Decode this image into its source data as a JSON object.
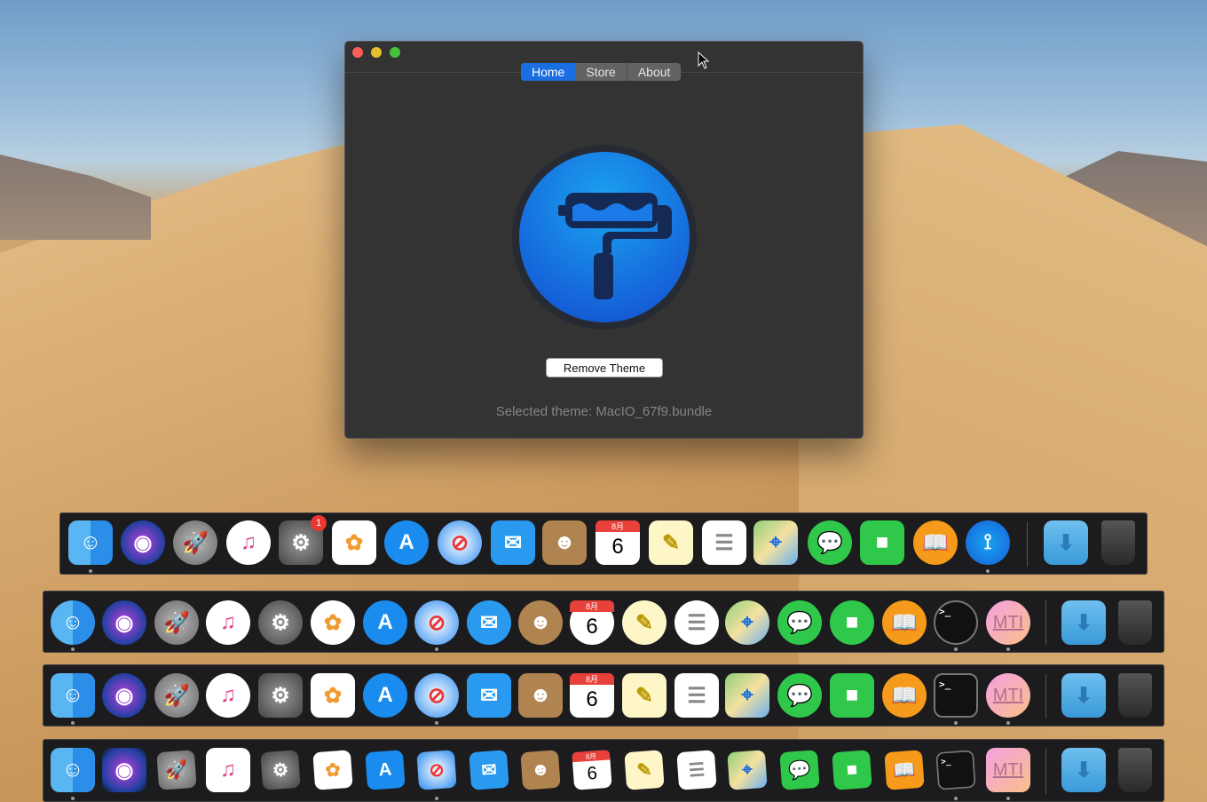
{
  "window": {
    "tabs": [
      {
        "label": "Home",
        "active": true
      },
      {
        "label": "Store",
        "active": false
      },
      {
        "label": "About",
        "active": false
      }
    ],
    "remove_button": "Remove Theme",
    "selected_theme": "Selected theme: MacIO_67f9.bundle",
    "logo_icon": "paint-roller-icon",
    "accent": "#1a6ee0"
  },
  "dock_text": {
    "calendar_month": "8月",
    "calendar_day": "6",
    "mti": "MTI",
    "terminal": ">_",
    "prefs_badge": "1"
  },
  "docks": [
    {
      "style": "custom-theme",
      "apps": [
        "finder",
        "siri",
        "launchpad",
        "itunes",
        "system-preferences",
        "photos",
        "app-store",
        "safari",
        "mail",
        "contacts",
        "calendar",
        "notes",
        "reminders",
        "maps",
        "messages",
        "facetime",
        "ibooks",
        "theme-app"
      ],
      "running": [
        "finder",
        "theme-app"
      ]
    },
    {
      "style": "round",
      "apps": [
        "finder",
        "siri",
        "launchpad",
        "itunes",
        "system-preferences",
        "photos",
        "app-store",
        "safari",
        "mail",
        "contacts",
        "calendar",
        "notes",
        "reminders",
        "maps",
        "messages",
        "facetime",
        "ibooks",
        "terminal",
        "mti"
      ],
      "running": [
        "finder",
        "safari",
        "terminal",
        "mti"
      ]
    },
    {
      "style": "flat",
      "apps": [
        "finder",
        "siri",
        "launchpad",
        "itunes",
        "system-preferences",
        "photos",
        "app-store",
        "safari",
        "mail",
        "contacts",
        "calendar",
        "notes",
        "reminders",
        "maps",
        "messages",
        "facetime",
        "ibooks",
        "terminal",
        "mti"
      ],
      "running": [
        "finder",
        "safari",
        "terminal",
        "mti"
      ]
    },
    {
      "style": "paper",
      "apps": [
        "finder",
        "siri",
        "launchpad",
        "itunes",
        "system-preferences",
        "photos",
        "app-store",
        "safari",
        "mail",
        "contacts",
        "calendar",
        "notes",
        "reminders",
        "maps",
        "messages",
        "facetime",
        "ibooks",
        "terminal",
        "mti"
      ],
      "running": [
        "finder",
        "safari",
        "terminal",
        "mti"
      ]
    }
  ]
}
